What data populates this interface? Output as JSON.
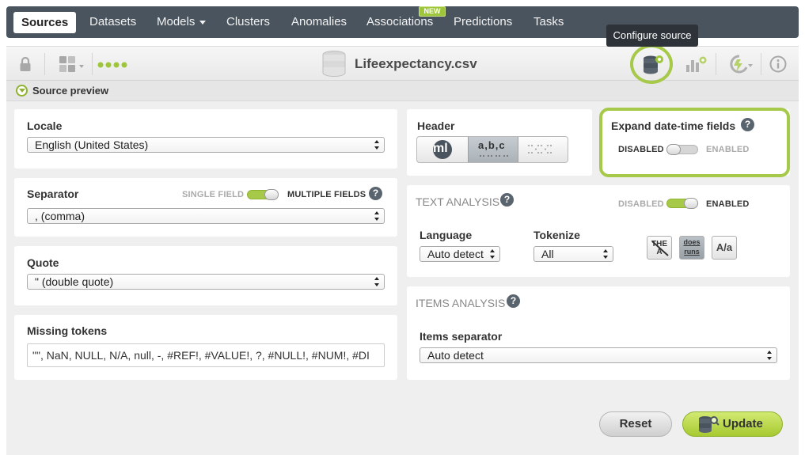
{
  "nav": {
    "items": [
      {
        "label": "Sources",
        "active": true
      },
      {
        "label": "Datasets"
      },
      {
        "label": "Models"
      },
      {
        "label": "Clusters"
      },
      {
        "label": "Anomalies"
      },
      {
        "label": "Associations"
      },
      {
        "label": "Predictions"
      },
      {
        "label": "Tasks"
      }
    ],
    "new_badge": "NEW"
  },
  "tooltip": "Configure source",
  "toolbar": {
    "file_name": "Lifeexpectancy.csv"
  },
  "preview": {
    "label": "Source preview"
  },
  "locale": {
    "label": "Locale",
    "value": "English (United States)"
  },
  "separator": {
    "label": "Separator",
    "single_label": "SINGLE FIELD",
    "multiple_label": "MULTIPLE FIELDS",
    "value": ", (comma)",
    "help": "?"
  },
  "quote": {
    "label": "Quote",
    "value": "\" (double quote)"
  },
  "missing": {
    "label": "Missing tokens",
    "value": "\"\", NaN, NULL, N/A, null, -, #REF!, #VALUE!, ?, #NULL!, #NUM!, #DI"
  },
  "header": {
    "label": "Header",
    "btn1": "ml",
    "btn2": "a,b,c"
  },
  "expand": {
    "label": "Expand date-time fields",
    "disabled_label": "DISABLED",
    "enabled_label": "ENABLED",
    "help": "?"
  },
  "text_analysis": {
    "label": "TEXT ANALYSIS",
    "help": "?",
    "disabled_label": "DISABLED",
    "enabled_label": "ENABLED",
    "language_label": "Language",
    "language_value": "Auto detect",
    "tokenize_label": "Tokenize",
    "tokenize_value": "All",
    "stopwords_btn": "THE A",
    "stem_btn_top": "does",
    "stem_btn_bottom": "runs",
    "case_btn": "A/a"
  },
  "items_analysis": {
    "label": "ITEMS ANALYSIS",
    "help": "?",
    "separator_label": "Items separator",
    "separator_value": "Auto detect"
  },
  "actions": {
    "reset": "Reset",
    "update": "Update"
  },
  "colors": {
    "accent": "#a6c94a",
    "nav_bg": "#4a545e"
  }
}
